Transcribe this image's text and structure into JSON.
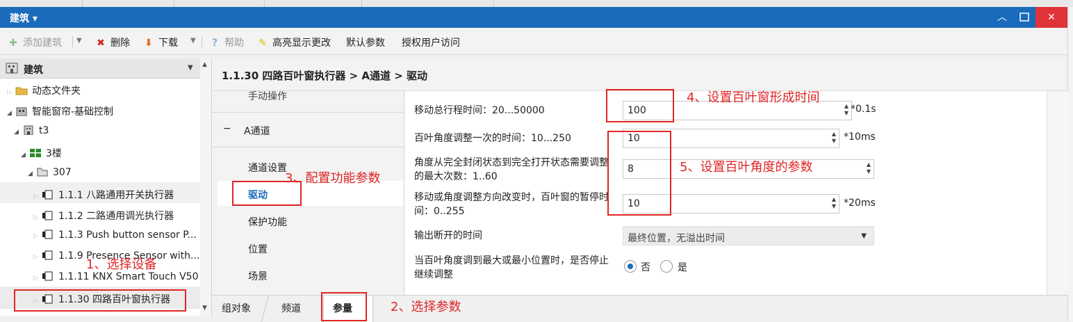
{
  "window": {
    "title": "建筑 ▾"
  },
  "toolbar": {
    "add_building": "添加建筑",
    "delete": "删除",
    "download": "下载",
    "help": "帮助",
    "highlight_changes": "高亮显示更改",
    "default_params": "默认参数",
    "authorize_access": "授权用户访问"
  },
  "tree": {
    "header": "建筑",
    "items": [
      {
        "label": "动态文件夹",
        "icon": "folder-icon"
      },
      {
        "label": "智能窗帘-基础控制",
        "icon": "building-icon"
      },
      {
        "label": "t3",
        "icon": "building-icon"
      },
      {
        "label": "3楼",
        "icon": "floor-icon"
      },
      {
        "label": "307",
        "icon": "room-icon"
      },
      {
        "label": "1.1.1 八路通用开关执行器",
        "icon": "device-icon"
      },
      {
        "label": "1.1.2 二路通用调光执行器",
        "icon": "device-icon"
      },
      {
        "label": "1.1.3 Push button sensor P...",
        "icon": "device-icon"
      },
      {
        "label": "1.1.9 Presence Sensor with...",
        "icon": "device-icon"
      },
      {
        "label": "1.1.11 KNX Smart Touch V50",
        "icon": "device-icon"
      },
      {
        "label": "1.1.30 四路百叶窗执行器",
        "icon": "device-icon"
      }
    ]
  },
  "breadcrumb": "1.1.30 四路百叶窗执行器 > A通道 > 驱动",
  "nav": {
    "manual": "手动操作",
    "collapse": "−",
    "channel": "A通道",
    "items": [
      "通道设置",
      "驱动",
      "保护功能",
      "位置",
      "场景"
    ]
  },
  "params": {
    "move_time": {
      "label": "移动总行程时间：20...50000",
      "value": "100",
      "unit": "*0.1s"
    },
    "angle_step": {
      "label": "百叶角度调整一次的时间：10...250",
      "value": "10",
      "unit": "*10ms"
    },
    "max_count": {
      "label1": "角度从完全封闭状态到完全打开状态需要调整",
      "label2": "的最大次数：1..60",
      "value": "8"
    },
    "pause": {
      "label1": "移动或角度调整方向改变时，百叶窗的暂停时",
      "label2": "间：0..255",
      "value": "10",
      "unit": "*20ms"
    },
    "output_off": {
      "label": "输出断开的时间",
      "value": "最终位置，无溢出时间"
    },
    "stop_adjust": {
      "label1": "当百叶角度调到最大或最小位置时，是否停止",
      "label2": "继续调整",
      "opt_no": "否",
      "opt_yes": "是",
      "selected": "否"
    }
  },
  "bottom_tabs": [
    "组对象",
    "频道",
    "参量"
  ],
  "annotations": {
    "a1": "1、选择设备",
    "a2": "2、选择参数",
    "a3": "3、配置功能参数",
    "a4": "4、设置百叶窗形成时间",
    "a5": "5、设置百叶角度的参数"
  },
  "colors": {
    "titlebar": "#1a6bbb",
    "annotation_red": "#e02525",
    "close": "#e0343a"
  }
}
